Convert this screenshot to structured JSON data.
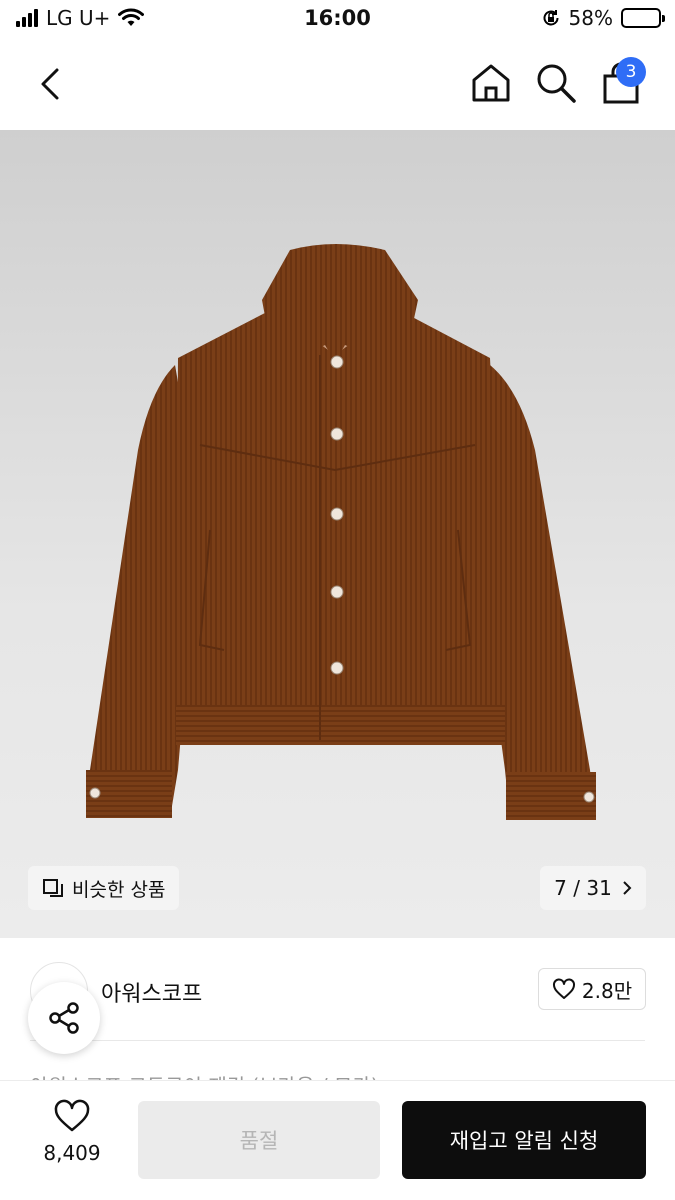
{
  "status_bar": {
    "carrier": "LG U+",
    "time": "16:00",
    "battery_percent": "58%",
    "battery_level": 0.58,
    "icons": [
      "signal-icon",
      "wifi-icon",
      "orientation-lock-icon",
      "battery-icon"
    ]
  },
  "nav": {
    "icons": [
      "back-icon",
      "home-icon",
      "search-icon",
      "shopping-bag-icon"
    ],
    "cart_badge": "3",
    "accent_color": "#2f6df6"
  },
  "hero": {
    "image": "brown corduroy trucker jacket",
    "similar_label": "비슷한 상품",
    "page_counter": "7 / 31"
  },
  "brand": {
    "name": "아워스코프",
    "likes": "2.8만"
  },
  "product": {
    "title": "아워스코프 코듀로이 재킷 (브라운 / 모카)"
  },
  "bottom_bar": {
    "wish_count": "8,409",
    "soldout_label": "품절",
    "restock_label": "재입고 알림 신청"
  }
}
